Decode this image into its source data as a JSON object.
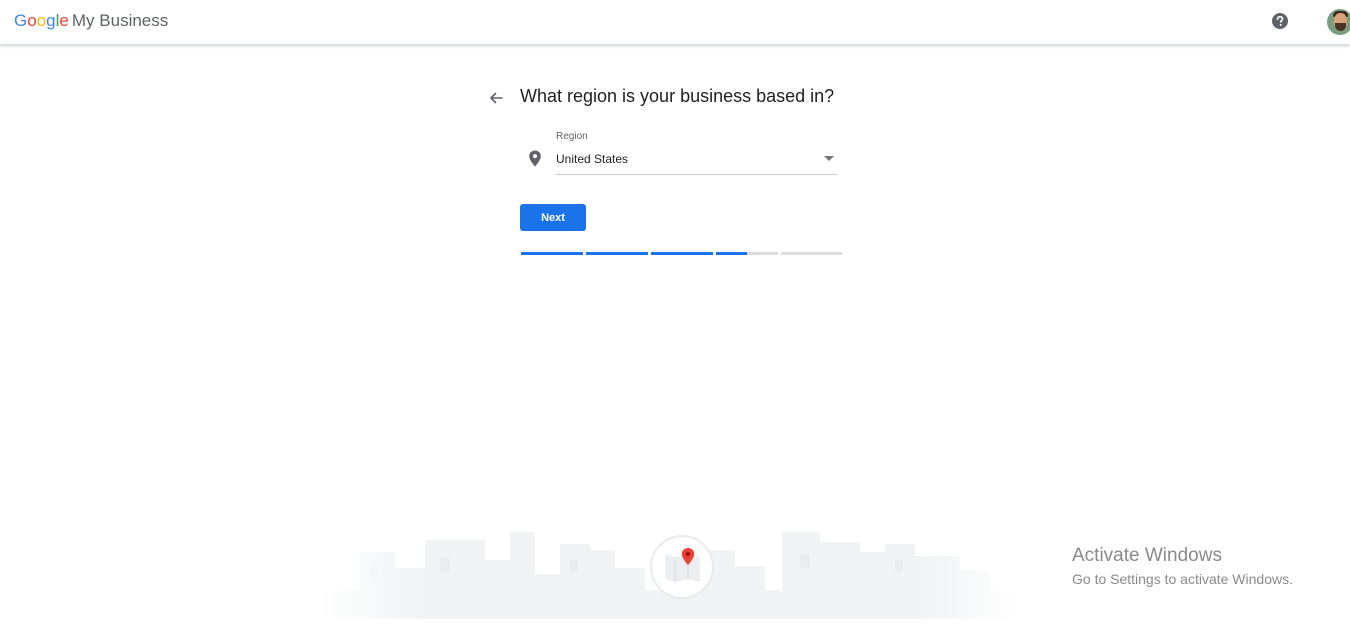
{
  "header": {
    "logo_letters": [
      {
        "char": "G",
        "color": "#4285F4"
      },
      {
        "char": "o",
        "color": "#EA4335"
      },
      {
        "char": "o",
        "color": "#FBBC05"
      },
      {
        "char": "g",
        "color": "#4285F4"
      },
      {
        "char": "l",
        "color": "#34A853"
      },
      {
        "char": "e",
        "color": "#EA4335"
      }
    ],
    "product_name": "My Business",
    "help_icon": "help-circle-icon",
    "avatar_icon": "user-avatar"
  },
  "main": {
    "back_icon": "arrow-back-icon",
    "title": "What region is your business based in?",
    "region_field": {
      "label": "Region",
      "value": "United States",
      "icon": "location-pin-icon",
      "dropdown_icon": "caret-down-icon"
    },
    "next_button": "Next",
    "progress": {
      "segments": [
        1,
        1,
        1,
        0.5,
        0
      ],
      "accent": "#1a73e8",
      "track": "#dadce0"
    }
  },
  "footer_illustration": {
    "icon": "city-skyline-map-pin-illustration"
  },
  "os_watermark": {
    "line1": "Activate Windows",
    "line2": "Go to Settings to activate Windows."
  }
}
